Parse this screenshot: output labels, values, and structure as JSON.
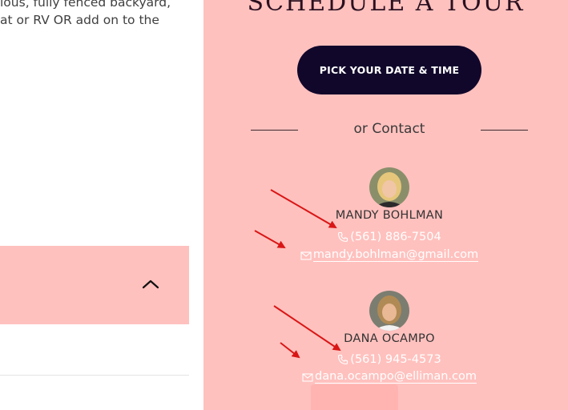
{
  "listing": {
    "desc_lines": [
      "ious, fully fenced backyard,",
      "at or RV OR add on to the"
    ]
  },
  "tour": {
    "title": "SCHEDULE A TOUR",
    "cta_label": "PICK YOUR DATE & TIME",
    "or_contact": "or Contact"
  },
  "agents": [
    {
      "name": "MANDY BOHLMAN",
      "phone": "(561) 886-7504",
      "email": "mandy.bohlman@gmail.com"
    },
    {
      "name": "DANA OCAMPO",
      "phone": "(561) 945-4573",
      "email": "dana.ocampo@elliman.com"
    }
  ],
  "colors": {
    "panel": "#ffc1be",
    "button": "#11072b",
    "annotation_arrow": "#d91616"
  },
  "icons": [
    "chevron-up-icon",
    "phone-icon",
    "envelope-icon",
    "annotation-arrow"
  ]
}
